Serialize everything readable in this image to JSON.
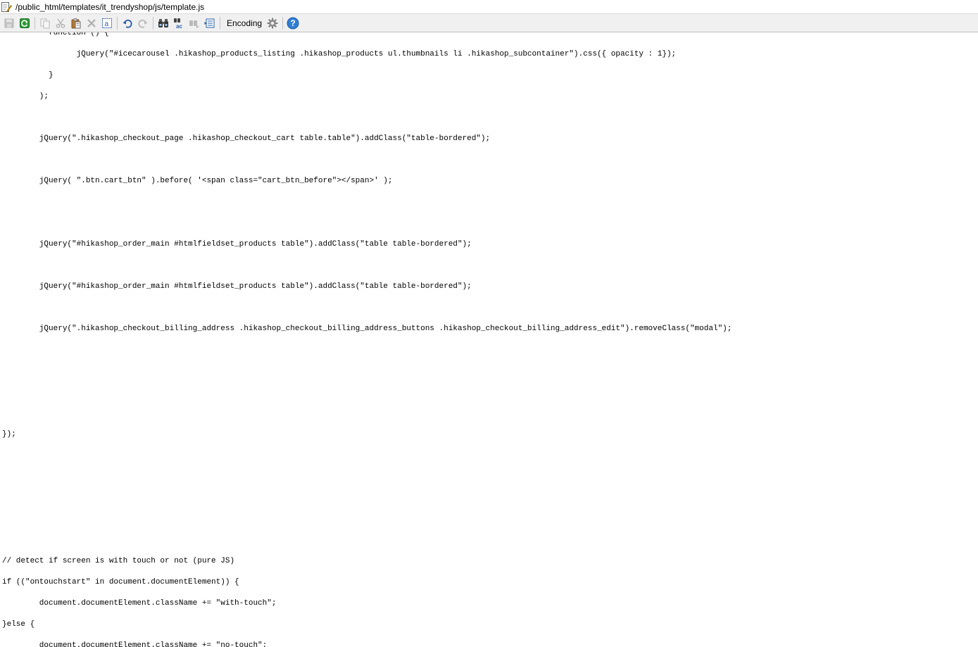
{
  "title": {
    "path": "/public_html/templates/it_trendyshop/js/template.js",
    "icon": "edit-file-icon"
  },
  "toolbar": {
    "encoding_label": "Encoding",
    "buttons": [
      {
        "name": "save-icon",
        "enabled": false
      },
      {
        "name": "reload-icon",
        "enabled": true
      },
      {
        "name": "copy-icon",
        "enabled": false
      },
      {
        "name": "cut-icon",
        "enabled": false
      },
      {
        "name": "paste-icon",
        "enabled": true
      },
      {
        "name": "delete-icon",
        "enabled": false
      },
      {
        "name": "select-all-icon",
        "enabled": true
      },
      {
        "name": "undo-icon",
        "enabled": true
      },
      {
        "name": "redo-icon",
        "enabled": false
      },
      {
        "name": "find-icon",
        "enabled": true
      },
      {
        "name": "replace-icon",
        "enabled": true
      },
      {
        "name": "find-next-icon",
        "enabled": false
      },
      {
        "name": "goto-line-icon",
        "enabled": true
      },
      {
        "name": "settings-gear-icon",
        "enabled": true
      },
      {
        "name": "help-icon",
        "enabled": true
      }
    ]
  },
  "editor": {
    "lines": [
      "          function () {",
      "                jQuery(\"#icecarousel .hikashop_products_listing .hikashop_products ul.thumbnails li .hikashop_subcontainer\").css({ opacity : 1});",
      "          }",
      "        );",
      "",
      "        jQuery(\".hikashop_checkout_page .hikashop_checkout_cart table.table\").addClass(\"table-bordered\");",
      "",
      "        jQuery( \".btn.cart_btn\" ).before( '<span class=\"cart_btn_before\"></span>' );",
      "",
      "",
      "        jQuery(\"#hikashop_order_main #htmlfieldset_products table\").addClass(\"table table-bordered\");",
      "",
      "        jQuery(\"#hikashop_order_main #htmlfieldset_products table\").addClass(\"table table-bordered\");",
      "",
      "        jQuery(\".hikashop_checkout_billing_address .hikashop_checkout_billing_address_buttons .hikashop_checkout_billing_address_edit\").removeClass(\"modal\");",
      "",
      "",
      "",
      "",
      "});",
      "",
      "",
      "",
      "",
      "",
      "// detect if screen is with touch or not (pure JS)",
      "if ((\"ontouchstart\" in document.documentElement)) {",
      "        document.documentElement.className += \"with-touch\";",
      "}else {",
      "        document.documentElement.className += \"no-touch\";"
    ]
  }
}
